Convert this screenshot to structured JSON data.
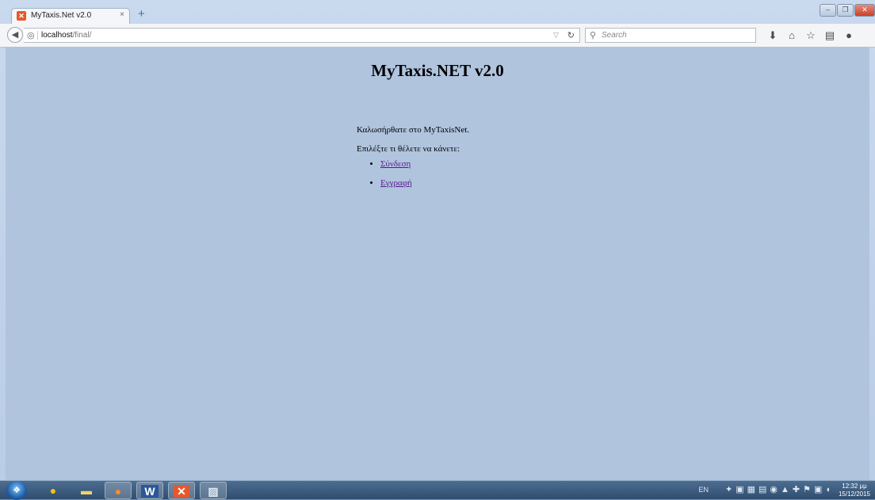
{
  "browser": {
    "tab_title": "MyTaxis.Net v2.0",
    "tab_close": "×",
    "new_tab": "+",
    "url_host": "localhost",
    "url_path": "/final/",
    "search_placeholder": "Search",
    "window_buttons": [
      "–",
      "❐",
      "✕"
    ],
    "toolbar_icons": [
      "download-icon",
      "home-icon",
      "bookmark-star-icon",
      "bookmarks-list-icon",
      "pocket-icon",
      "menu-icon"
    ]
  },
  "page": {
    "title": "MyTaxis.NET v2.0",
    "welcome": "Καλωσήρθατε στο MyTaxisNet.",
    "prompt": "Επιλέξτε τι θέλετε να κάνετε:",
    "links": {
      "login": "Σύνδεση",
      "register": "Εγγραφή"
    },
    "background_color": "#b0c4de",
    "link_color": "#551a8b"
  },
  "taskbar": {
    "apps": [
      "chrome-icon",
      "file-explorer-icon",
      "firefox-icon",
      "word-icon",
      "xampp-icon",
      "sublime-icon"
    ],
    "language": "EN",
    "clock_time": "12:32 μμ",
    "clock_date": "15/12/2015"
  }
}
